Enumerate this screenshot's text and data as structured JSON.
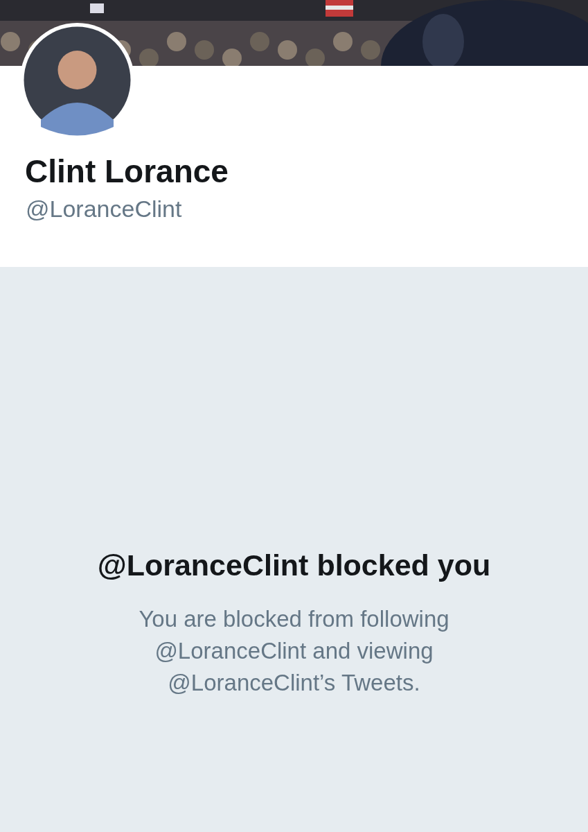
{
  "profile": {
    "name": "Clint Lorance",
    "handle": "@LoranceClint"
  },
  "blocked_notice": {
    "title": "@LoranceClint blocked you",
    "message": "You are blocked from following @LoranceClint and viewing @LoranceClint’s Tweets."
  }
}
